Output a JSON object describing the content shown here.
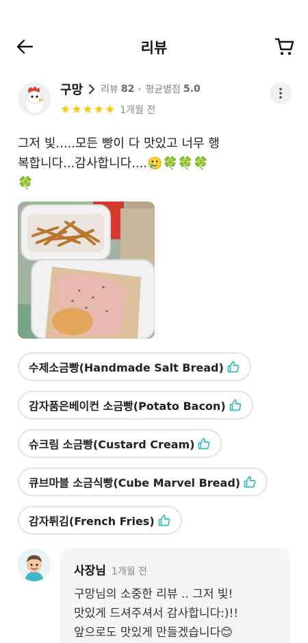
{
  "header": {
    "title": "리뷰",
    "back_icon": "arrow-left-icon",
    "cart_icon": "cart-icon"
  },
  "review": {
    "nickname": "구망",
    "review_count_label": "리뷰",
    "review_count": "82",
    "avg_rating_label": "평균별점",
    "avg_rating": "5.0",
    "stars": 5,
    "date": "1개월 전",
    "text_line1": "그저 빛.....모든 빵이 다 맛있고 너무 행",
    "text_line2": "복합니다...감사합니다....🥲🍀🍀🍀",
    "text_line3": "🍀",
    "star_color": "#FFC40C"
  },
  "items": [
    {
      "label": "수제소금빵(Handmade Salt Bread)"
    },
    {
      "label": "감자품은베이컨 소금빵(Potato Bacon)"
    },
    {
      "label": "슈크림 소금빵(Custard Cream)"
    },
    {
      "label": "큐브마블 소금식빵(Cube Marvel Bread)"
    },
    {
      "label": "감자튀김(French Fries)"
    }
  ],
  "owner_reply": {
    "name": "사장님",
    "date": "1개월 전",
    "line1": "구망님의 소중한 리뷰 .. 그저 빛!",
    "line2": "맛있게 드셔주셔서 감사합니다:)!!",
    "line3": "앞으로도 맛있게 만들겠습니다😊"
  },
  "colors": {
    "accent": "#2AC1BC",
    "star": "#FFC40C"
  }
}
